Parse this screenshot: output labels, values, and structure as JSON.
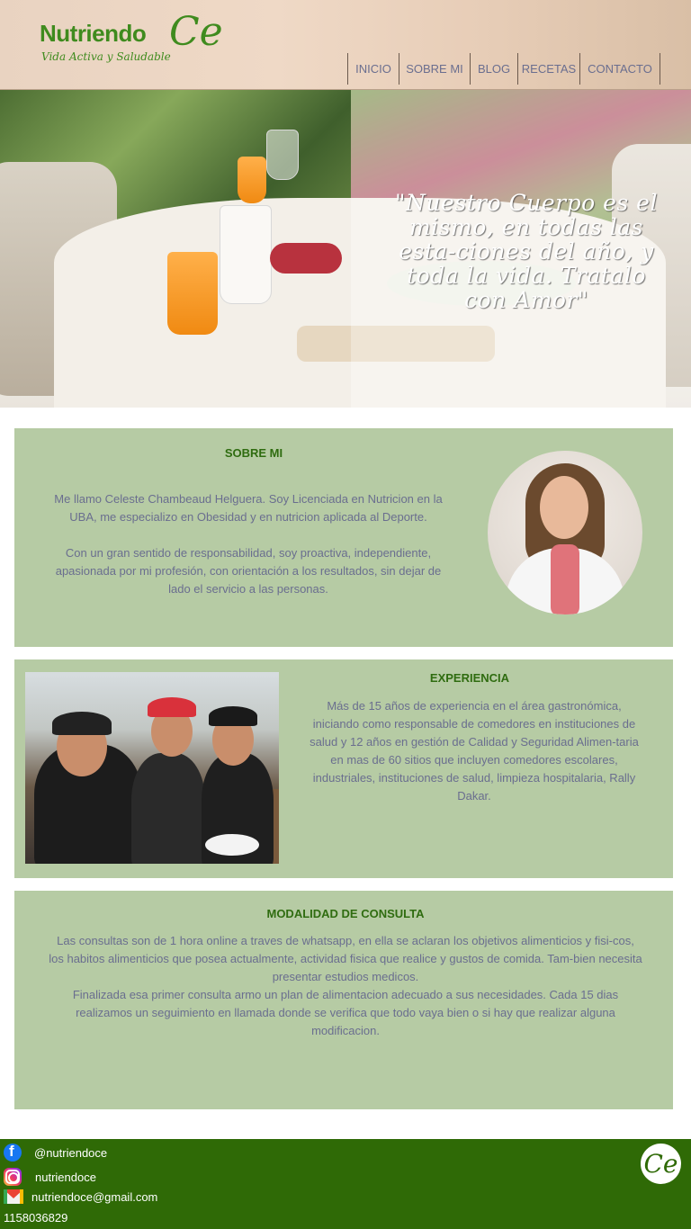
{
  "header": {
    "logo": {
      "main": "Nutriendo",
      "ce": "Ce",
      "tagline": "Vida Activa y Saludable"
    },
    "nav": [
      "INICIO",
      "SOBRE MI",
      "BLOG",
      "RECETAS",
      "CONTACTO"
    ]
  },
  "hero": {
    "quote": "\"Nuestro Cuerpo es el mismo, en todas las esta-ciones del año, y toda la vida. Tratalo con Amor\""
  },
  "about": {
    "title": "SOBRE MI",
    "paragraph1": "Me llamo Celeste Chambeaud Helguera. Soy Licenciada en Nutricion en la UBA, me especializo en Obesidad y en nutricion aplicada al Deporte.",
    "paragraph2": "Con un gran sentido de responsabilidad, soy proactiva, independiente, apasionada por mi profesión, con orientación a los resultados, sin dejar de lado el servicio a las personas."
  },
  "experience": {
    "title": "EXPERIENCIA",
    "text": "Más de 15 años de experiencia en el área gastronómica, iniciando como responsable de comedores en instituciones de salud y 12 años en gestión de Calidad y Seguridad Alimen-taria en mas de 60 sitios que incluyen comedores escolares, industriales, instituciones de salud, limpieza hospitalaria, Rally Dakar."
  },
  "consultation": {
    "title": "MODALIDAD DE CONSULTA",
    "paragraph1": "Las consultas son de 1 hora online a traves de whatsapp, en ella se aclaran los objetivos alimenticios y fisi-cos, los habitos alimenticios que posea actualmente, actividad fisica que realice y gustos de comida. Tam-bien necesita presentar estudios medicos.",
    "paragraph2": "Finalizada esa primer consulta armo un plan de alimentacion adecuado a sus necesidades. Cada 15 dias realizamos un seguimiento en llamada donde se verifica que todo vaya bien o si hay que realizar alguna modificacion."
  },
  "footer": {
    "facebook": "@nutriendoce",
    "instagram": "nutriendoce",
    "email": "nutriendoce@gmail.com",
    "phone": "1158036829",
    "logo": "Ce"
  },
  "colors": {
    "panel": "#b6cba4",
    "title_green": "#2f6c10",
    "body_text": "#6a6e8f",
    "footer": "#2f6a06"
  }
}
